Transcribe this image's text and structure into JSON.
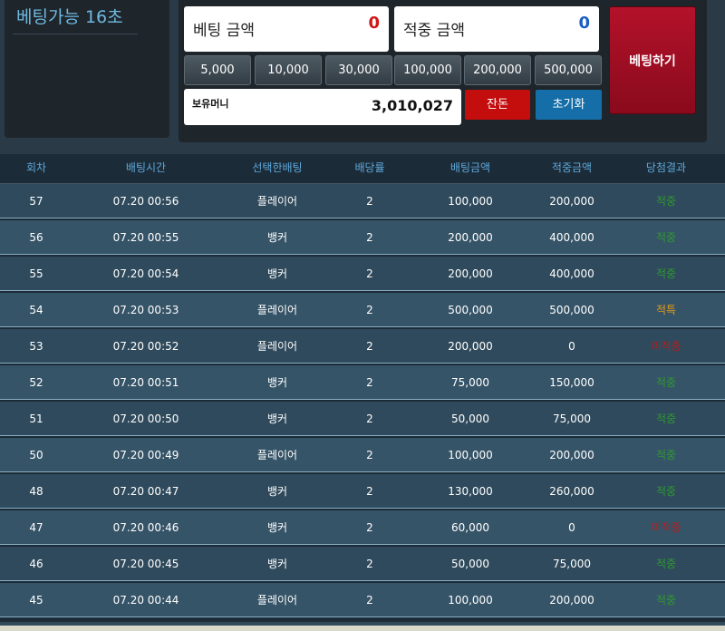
{
  "timer": {
    "text": "베팅가능 16초"
  },
  "bet_panel": {
    "bet_amount": {
      "label": "베팅 금액",
      "value": "0"
    },
    "hit_amount": {
      "label": "적중 금액",
      "value": "0"
    },
    "chips": [
      "5,000",
      "10,000",
      "30,000",
      "100,000",
      "200,000",
      "500,000"
    ],
    "balance": {
      "label": "보유머니",
      "value": "3,010,027"
    },
    "change_label": "잔돈",
    "reset_label": "초기화",
    "bet_button_label": "베팅하기"
  },
  "table": {
    "headers": [
      "회차",
      "배팅시간",
      "선택한배팅",
      "배당률",
      "배팅금액",
      "적중금액",
      "당첨결과"
    ],
    "rows": [
      {
        "round": "57",
        "time": "07.20 00:56",
        "pick": "플레이어",
        "odds": "2",
        "bet": "100,000",
        "win": "200,000",
        "result": "적중",
        "status": "win"
      },
      {
        "round": "56",
        "time": "07.20 00:55",
        "pick": "뱅커",
        "odds": "2",
        "bet": "200,000",
        "win": "400,000",
        "result": "적중",
        "status": "win"
      },
      {
        "round": "55",
        "time": "07.20 00:54",
        "pick": "뱅커",
        "odds": "2",
        "bet": "200,000",
        "win": "400,000",
        "result": "적중",
        "status": "win"
      },
      {
        "round": "54",
        "time": "07.20 00:53",
        "pick": "플레이어",
        "odds": "2",
        "bet": "500,000",
        "win": "500,000",
        "result": "적특",
        "status": "tie"
      },
      {
        "round": "53",
        "time": "07.20 00:52",
        "pick": "플레이어",
        "odds": "2",
        "bet": "200,000",
        "win": "0",
        "result": "미적중",
        "status": "lose"
      },
      {
        "round": "52",
        "time": "07.20 00:51",
        "pick": "뱅커",
        "odds": "2",
        "bet": "75,000",
        "win": "150,000",
        "result": "적중",
        "status": "win"
      },
      {
        "round": "51",
        "time": "07.20 00:50",
        "pick": "뱅커",
        "odds": "2",
        "bet": "50,000",
        "win": "75,000",
        "result": "적중",
        "status": "win"
      },
      {
        "round": "50",
        "time": "07.20 00:49",
        "pick": "플레이어",
        "odds": "2",
        "bet": "100,000",
        "win": "200,000",
        "result": "적중",
        "status": "win"
      },
      {
        "round": "48",
        "time": "07.20 00:47",
        "pick": "뱅커",
        "odds": "2",
        "bet": "130,000",
        "win": "260,000",
        "result": "적중",
        "status": "win"
      },
      {
        "round": "47",
        "time": "07.20 00:46",
        "pick": "뱅커",
        "odds": "2",
        "bet": "60,000",
        "win": "0",
        "result": "미적중",
        "status": "lose"
      },
      {
        "round": "46",
        "time": "07.20 00:45",
        "pick": "뱅커",
        "odds": "2",
        "bet": "50,000",
        "win": "75,000",
        "result": "적중",
        "status": "win"
      },
      {
        "round": "45",
        "time": "07.20 00:44",
        "pick": "플레이어",
        "odds": "2",
        "bet": "100,000",
        "win": "200,000",
        "result": "적중",
        "status": "win"
      }
    ]
  },
  "colors": {
    "win": "#2e9a2e",
    "lose": "#b51d1d",
    "tie": "#e59b18",
    "header_text": "#5ea8da",
    "bet_button": "#b3122a"
  }
}
